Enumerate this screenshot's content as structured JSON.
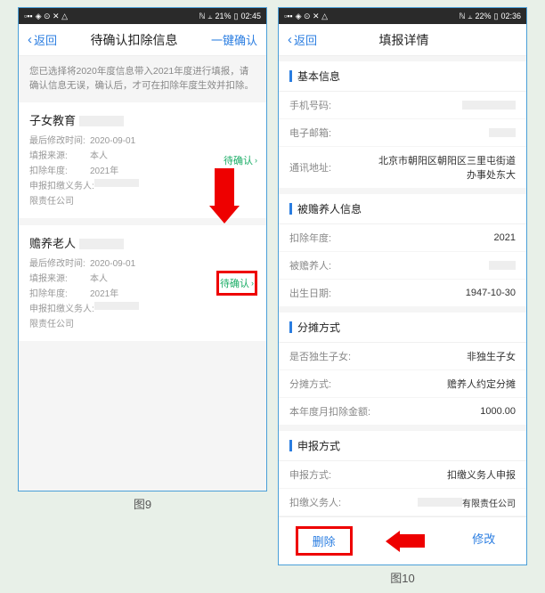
{
  "left": {
    "status": {
      "battery": "21%",
      "time": "02:45"
    },
    "nav": {
      "back": "返回",
      "title": "待确认扣除信息",
      "action": "一键确认"
    },
    "notice": "您已选择将2020年度信息带入2021年度进行填报，请确认信息无误，确认后，才可在扣除年度生效并扣除。",
    "cards": [
      {
        "title": "子女教育",
        "fields": [
          {
            "label": "最后修改时间:",
            "value": "2020-09-01"
          },
          {
            "label": "填报来源:",
            "value": "本人"
          },
          {
            "label": "扣除年度:",
            "value": "2021年"
          },
          {
            "label": "申报扣缴义务人:",
            "value": ""
          },
          {
            "label": "限责任公司",
            "value": ""
          }
        ],
        "tag": "待确认"
      },
      {
        "title": "赡养老人",
        "fields": [
          {
            "label": "最后修改时间:",
            "value": "2020-09-01"
          },
          {
            "label": "填报来源:",
            "value": "本人"
          },
          {
            "label": "扣除年度:",
            "value": "2021年"
          },
          {
            "label": "申报扣缴义务人:",
            "value": ""
          },
          {
            "label": "限责任公司",
            "value": ""
          }
        ],
        "tag": "待确认"
      }
    ],
    "caption": "图9"
  },
  "right": {
    "status": {
      "battery": "22%",
      "time": "02:36"
    },
    "nav": {
      "back": "返回",
      "title": "填报详情",
      "action": ""
    },
    "sections": [
      {
        "header": "基本信息",
        "rows": [
          {
            "label": "手机号码:",
            "value": ""
          },
          {
            "label": "电子邮箱:",
            "value": ""
          },
          {
            "label": "通讯地址:",
            "value": "北京市朝阳区朝阳区三里屯街道办事处东大"
          }
        ]
      },
      {
        "header": "被赡养人信息",
        "rows": [
          {
            "label": "扣除年度:",
            "value": "2021"
          },
          {
            "label": "被赡养人:",
            "value": ""
          },
          {
            "label": "出生日期:",
            "value": "1947-10-30"
          }
        ]
      },
      {
        "header": "分摊方式",
        "rows": [
          {
            "label": "是否独生子女:",
            "value": "非独生子女"
          },
          {
            "label": "分摊方式:",
            "value": "赡养人约定分摊"
          },
          {
            "label": "本年度月扣除金额:",
            "value": "1000.00"
          }
        ]
      },
      {
        "header": "申报方式",
        "rows": [
          {
            "label": "申报方式:",
            "value": "扣缴义务人申报"
          },
          {
            "label": "扣缴义务人:",
            "value": "有限责任公司"
          }
        ]
      }
    ],
    "buttons": {
      "delete": "删除",
      "modify": "修改"
    },
    "caption": "图10"
  }
}
